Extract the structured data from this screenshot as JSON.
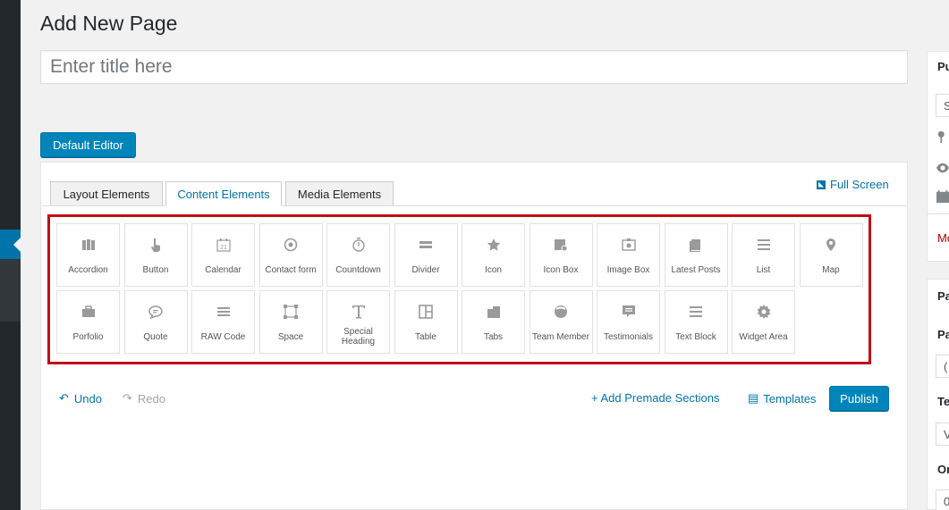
{
  "page_title": "Add New Page",
  "title_input": {
    "placeholder": "Enter title here",
    "value": ""
  },
  "default_editor_label": "Default Editor",
  "tabs": [
    {
      "label": "Layout Elements",
      "active": false
    },
    {
      "label": "Content Elements",
      "active": true
    },
    {
      "label": "Media Elements",
      "active": false
    }
  ],
  "fullscreen_label": "Full Screen",
  "elements": [
    {
      "label": "Accordion",
      "icon": "accordion-icon"
    },
    {
      "label": "Button",
      "icon": "pointer-hand-icon"
    },
    {
      "label": "Calendar",
      "icon": "calendar-icon"
    },
    {
      "label": "Contact form",
      "icon": "at-sign-icon"
    },
    {
      "label": "Countdown",
      "icon": "stopwatch-icon"
    },
    {
      "label": "Divider",
      "icon": "divider-icon"
    },
    {
      "label": "Icon",
      "icon": "star-icon"
    },
    {
      "label": "Icon Box",
      "icon": "icon-box-icon"
    },
    {
      "label": "Image Box",
      "icon": "image-box-icon"
    },
    {
      "label": "Latest Posts",
      "icon": "posts-icon"
    },
    {
      "label": "List",
      "icon": "list-icon"
    },
    {
      "label": "Map",
      "icon": "map-pin-icon"
    },
    {
      "label": "Porfolio",
      "icon": "briefcase-icon"
    },
    {
      "label": "Quote",
      "icon": "speech-bubble-icon"
    },
    {
      "label": "RAW Code",
      "icon": "lines-icon"
    },
    {
      "label": "Space",
      "icon": "space-square-icon"
    },
    {
      "label": "Special Heading",
      "icon": "text-t-icon"
    },
    {
      "label": "Table",
      "icon": "table-icon"
    },
    {
      "label": "Tabs",
      "icon": "tabs-icon"
    },
    {
      "label": "Team Member",
      "icon": "person-icon"
    },
    {
      "label": "Testimonials",
      "icon": "testimonial-icon"
    },
    {
      "label": "Text Block",
      "icon": "text-lines-icon"
    },
    {
      "label": "Widget Area",
      "icon": "gear-icon"
    }
  ],
  "toolbar": {
    "undo_label": "Undo",
    "redo_label": "Redo",
    "premade_label": "+ Add Premade Sections",
    "templates_label": "Templates",
    "publish_label": "Publish"
  },
  "sidebar": {
    "publish_heading": "Pu",
    "save_field": "S",
    "move_to_trash": "Mo",
    "page_attr_heading": "Pa",
    "parent_label": "Pa",
    "parent_value": "(",
    "template_label": "Te",
    "template_value": "V",
    "order_label": "Or",
    "order_value": "0"
  },
  "colors": {
    "accent": "#0073aa",
    "button": "#0085ba",
    "highlight_frame": "#c00f17",
    "admin_sidebar": "#23282d"
  }
}
